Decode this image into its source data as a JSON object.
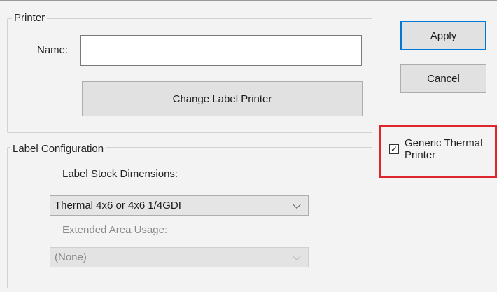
{
  "printer_group": {
    "title": "Printer",
    "name_label": "Name:",
    "name_value": "",
    "change_button": "Change Label Printer"
  },
  "label_config": {
    "title": "Label Configuration",
    "stock_label": "Label Stock Dimensions:",
    "stock_value": "Thermal 4x6 or 4x6 1/4GDI",
    "extended_label": "Extended Area Usage:",
    "extended_value": "(None)",
    "extended_enabled": false
  },
  "actions": {
    "apply": "Apply",
    "cancel": "Cancel"
  },
  "generic_thermal": {
    "label": "Generic Thermal Printer",
    "checked": true,
    "check_glyph": "✓",
    "highlight_color": "#e0242c"
  },
  "icons": {
    "dropdown": "chevron-down-icon"
  }
}
